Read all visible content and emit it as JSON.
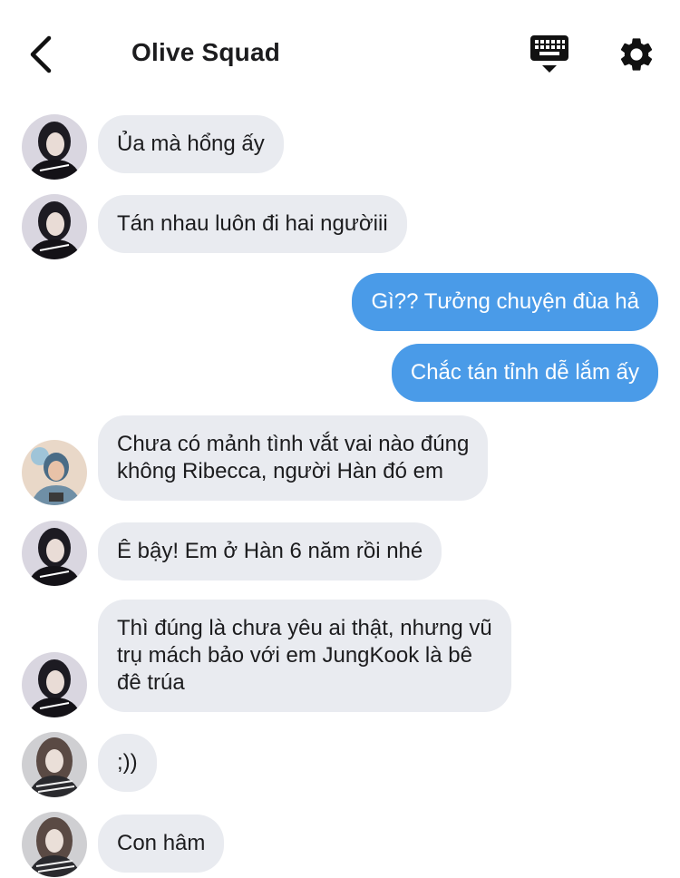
{
  "header": {
    "title": "Olive Squad",
    "back_icon": "chevron-left-icon",
    "keyboard_icon": "keyboard-icon",
    "settings_icon": "gear-icon"
  },
  "colors": {
    "incoming_bubble": "#e9ebf0",
    "outgoing_bubble": "#4a9be8",
    "outgoing_text": "#ffffff"
  },
  "messages": [
    {
      "direction": "in",
      "avatar": "user-a",
      "text": "Ủa mà hổng ấy"
    },
    {
      "direction": "in",
      "avatar": "user-a",
      "text": "Tán nhau luôn đi hai ngườiii"
    },
    {
      "direction": "out",
      "text": "Gì?? Tưởng chuyện đùa hả"
    },
    {
      "direction": "out",
      "text": "Chắc tán tỉnh dễ lắm ấy"
    },
    {
      "direction": "in",
      "avatar": "user-b",
      "text": "Chưa có mảnh tình vắt vai nào đúng\nkhông Ribecca, người Hàn đó em"
    },
    {
      "direction": "in",
      "avatar": "user-a",
      "text": "Ê bậy! Em ở Hàn 6 năm rồi nhé"
    },
    {
      "direction": "in",
      "avatar": "user-a",
      "text": "Thì đúng là chưa yêu ai thật, nhưng vũ\ntrụ mách bảo với em JungKook là bê\nđê trúa"
    },
    {
      "direction": "in",
      "avatar": "user-c",
      "text": ";))"
    },
    {
      "direction": "in",
      "avatar": "user-c",
      "text": "Con hâm"
    }
  ]
}
